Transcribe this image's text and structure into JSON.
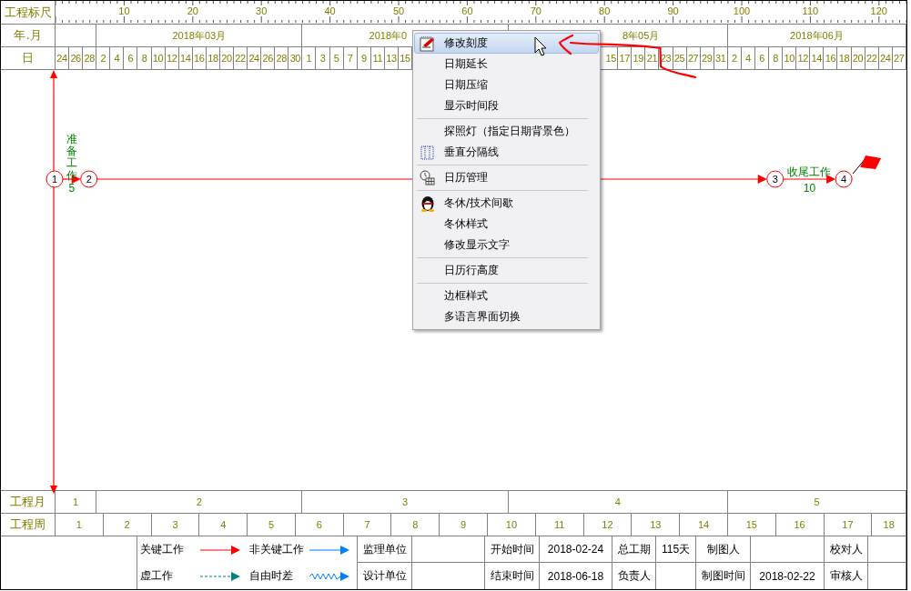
{
  "ruler": {
    "label": "工程标尺",
    "ticks": [
      "10",
      "20",
      "30",
      "40",
      "50",
      "60",
      "70",
      "80",
      "90",
      "100",
      "110",
      "120"
    ]
  },
  "month_row": {
    "label": "年.月"
  },
  "day_row": {
    "label": "日"
  },
  "months": [
    {
      "days": [
        "24",
        "26",
        "28"
      ]
    },
    {
      "label": "2018年03月",
      "days": [
        "2",
        "4",
        "6",
        "8",
        "10",
        "12",
        "14",
        "16",
        "18",
        "20",
        "22",
        "24",
        "26",
        "28",
        "30"
      ]
    },
    {
      "label": "2018年0",
      "days": [
        "1",
        "3",
        "5",
        "7",
        "9",
        "11",
        "13",
        "15"
      ]
    },
    {
      "label": "8年05月",
      "days": [
        "15",
        "17",
        "19",
        "21",
        "23",
        "25",
        "27",
        "29",
        "31"
      ]
    },
    {
      "label": "2018年06月",
      "days": [
        "2",
        "4",
        "6",
        "8",
        "10",
        "12",
        "14",
        "16",
        "18",
        "20",
        "22",
        "24",
        "27"
      ]
    }
  ],
  "network": {
    "nodes": [
      "1",
      "2",
      "3",
      "4"
    ],
    "tasks": [
      {
        "kind": "critical",
        "name": "准备工作",
        "duration": "5"
      },
      {
        "kind": "critical"
      },
      {
        "kind": "critical",
        "name": "收尾工作",
        "duration": "10"
      }
    ]
  },
  "project_months": {
    "label": "工程月",
    "cells": [
      "1",
      "2",
      "3",
      "4",
      "5"
    ]
  },
  "project_weeks": {
    "label": "工程周",
    "cells": [
      "1",
      "2",
      "3",
      "4",
      "5",
      "6",
      "7",
      "8",
      "9",
      "10",
      "11",
      "12",
      "13",
      "14",
      "15",
      "16",
      "17",
      "18"
    ]
  },
  "legend": [
    {
      "label": "关键工作",
      "kind": "critical"
    },
    {
      "label": "非关键工作",
      "kind": "noncritical"
    },
    {
      "label": "虚工作",
      "kind": "dummy"
    },
    {
      "label": "自由时差",
      "kind": "float"
    }
  ],
  "info_table": {
    "rows": [
      [
        {
          "label": "监理单位"
        },
        {
          "label": "开始时间",
          "value": "2018-02-24"
        },
        {
          "label": "总工期",
          "value": "115天"
        },
        {
          "label": "制图人"
        },
        {
          "label": "校对人"
        }
      ],
      [
        {
          "label": "设计单位"
        },
        {
          "label": "结束时间",
          "value": "2018-06-18"
        },
        {
          "label": "负责人"
        },
        {
          "label": "制图时间",
          "value": "2018-02-22"
        },
        {
          "label": "审核人"
        }
      ]
    ]
  },
  "context_menu": {
    "items": [
      {
        "kind": "item",
        "label": "修改刻度",
        "selected": true
      },
      {
        "kind": "item",
        "label": "日期延长",
        "selected": false
      },
      {
        "kind": "item",
        "label": "日期压缩",
        "selected": false
      },
      {
        "kind": "item",
        "label": "显示时间段",
        "selected": false
      },
      {
        "kind": "separator"
      },
      {
        "kind": "item",
        "label": "探照灯（指定日期背景色）",
        "selected": false
      },
      {
        "kind": "item",
        "label": "垂直分隔线",
        "selected": false
      },
      {
        "kind": "separator"
      },
      {
        "kind": "item",
        "label": "日历管理",
        "selected": false
      },
      {
        "kind": "separator"
      },
      {
        "kind": "item",
        "label": "冬休/技术间歇",
        "selected": false
      },
      {
        "kind": "item",
        "label": "冬休样式",
        "selected": false
      },
      {
        "kind": "item",
        "label": "修改显示文字",
        "selected": false
      },
      {
        "kind": "separator"
      },
      {
        "kind": "item",
        "label": "日历行高度",
        "selected": false
      },
      {
        "kind": "separator"
      },
      {
        "kind": "item",
        "label": "边框样式",
        "selected": false
      },
      {
        "kind": "item",
        "label": "多语言界面切换",
        "selected": false
      }
    ]
  }
}
